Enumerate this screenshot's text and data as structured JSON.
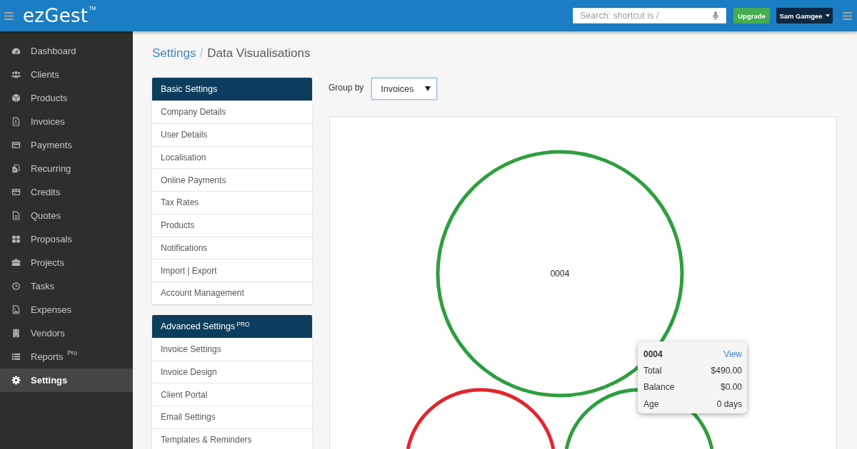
{
  "topbar": {
    "logo": "ezGest",
    "trademark": "TM",
    "search": {
      "placeholder": "Search: shortcut is /"
    },
    "upgrade_button": "Upgrade",
    "user_menu": "Sam Gamgee"
  },
  "sidebar": {
    "items": [
      {
        "label": "Dashboard",
        "selected": false
      },
      {
        "label": "Clients",
        "selected": false
      },
      {
        "label": "Products",
        "selected": false
      },
      {
        "label": "Invoices",
        "selected": false
      },
      {
        "label": "Payments",
        "selected": false
      },
      {
        "label": "Recurring",
        "selected": false
      },
      {
        "label": "Credits",
        "selected": false
      },
      {
        "label": "Quotes",
        "selected": false
      },
      {
        "label": "Proposals",
        "selected": false
      },
      {
        "label": "Projects",
        "selected": false
      },
      {
        "label": "Tasks",
        "selected": false
      },
      {
        "label": "Expenses",
        "selected": false
      },
      {
        "label": "Vendors",
        "selected": false
      },
      {
        "label": "Reports $^{Pro}$",
        "selected": false
      },
      {
        "label": "Settings",
        "selected": true
      }
    ]
  },
  "breadcrumb": {
    "separator": "/",
    "items": [
      {
        "label": "Settings",
        "kind": "link"
      },
      {
        "label": "Data Visualisations",
        "kind": "current"
      }
    ]
  },
  "settings_menu": [
    {
      "title": "Basic Settings",
      "items": [
        {
          "label": "Company Details",
          "selected": false
        },
        {
          "label": "User Details",
          "selected": false
        },
        {
          "label": "Localisation",
          "selected": false
        },
        {
          "label": "Online Payments",
          "selected": false
        },
        {
          "label": "Tax Rates",
          "selected": false
        },
        {
          "label": "Products",
          "selected": false
        },
        {
          "label": "Notifications",
          "selected": false
        },
        {
          "label": "Import | Export",
          "selected": false
        },
        {
          "label": "Account Management",
          "selected": false
        }
      ]
    },
    {
      "title": "Advanced Settings $^{PRO}$",
      "items": [
        {
          "label": "Invoice Settings",
          "selected": false
        },
        {
          "label": "Invoice Design",
          "selected": false
        },
        {
          "label": "Client Portal",
          "selected": false
        },
        {
          "label": "Email Settings",
          "selected": false
        },
        {
          "label": "Templates & Reminders",
          "selected": false
        }
      ]
    }
  ],
  "group_by": {
    "label": "Group by",
    "value": "Invoices"
  },
  "chart": {
    "bubbles": [
      {
        "label": "0004",
        "color": "#2e9e3e"
      },
      {
        "color": "#e3262e"
      },
      {
        "color": "#2e9e3e"
      }
    ],
    "tooltip": {
      "title": "0004",
      "link": "View",
      "rows": [
        {
          "label": "Total",
          "value": "$490.00"
        },
        {
          "label": "Balance",
          "value": "$0.00"
        },
        {
          "label": "Age",
          "value": "0 days"
        }
      ]
    }
  }
}
